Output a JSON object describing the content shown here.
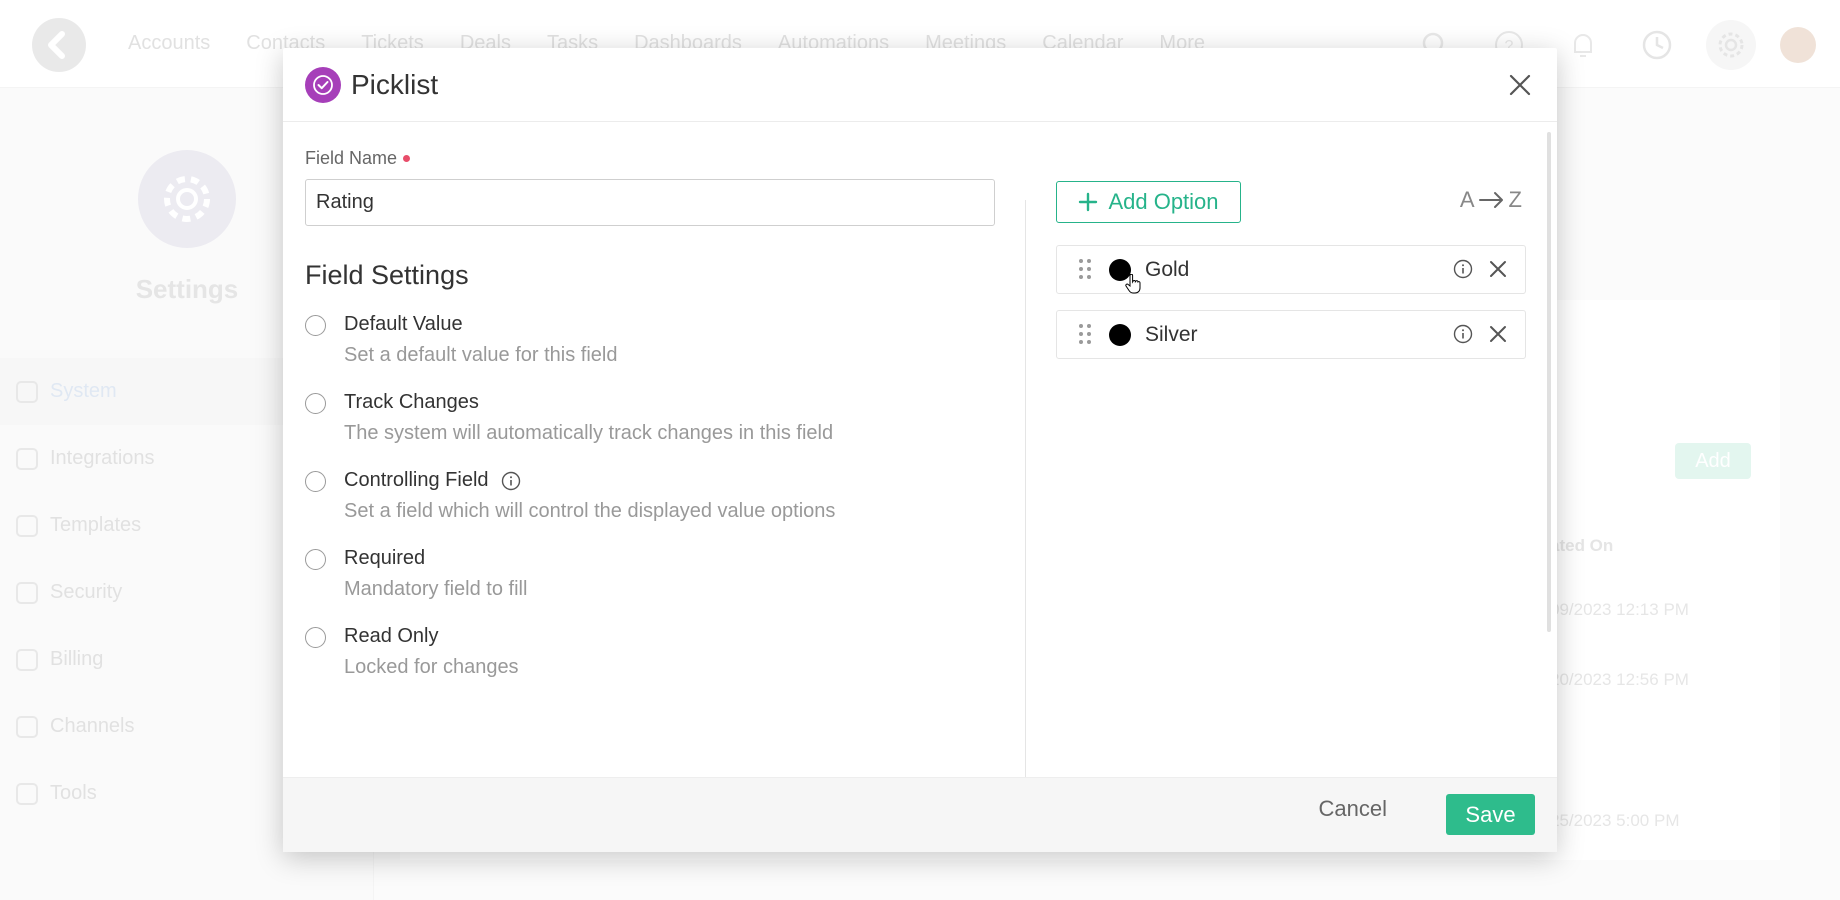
{
  "background": {
    "nav": [
      "Accounts",
      "Contacts",
      "Tickets",
      "Deals",
      "Tasks",
      "Dashboards",
      "Automations",
      "Meetings",
      "Calendar",
      "More"
    ],
    "settings_title": "Settings",
    "sidebar": [
      {
        "label": "System",
        "icon": "gear-icon"
      },
      {
        "label": "Integrations",
        "icon": "share-icon"
      },
      {
        "label": "Templates",
        "icon": "template-icon"
      },
      {
        "label": "Security",
        "icon": "shield-icon"
      },
      {
        "label": "Billing",
        "icon": "card-icon"
      },
      {
        "label": "Channels",
        "icon": "channels-icon"
      },
      {
        "label": "Tools",
        "icon": "tools-icon"
      }
    ],
    "add_label": "Add",
    "column_header": "ated On",
    "rows": [
      "09/2023 12:13 PM",
      "20/2023 12:56 PM",
      "25/2023 5:00 PM"
    ]
  },
  "modal": {
    "title": "Picklist",
    "icon": "check-circle-icon",
    "accent": "#a63fb9",
    "field_name_label": "Field Name",
    "field_name_value": "Rating",
    "settings_title": "Field Settings",
    "settings": [
      {
        "name": "Default Value",
        "desc": "Set a default value for this field",
        "info": false
      },
      {
        "name": "Track Changes",
        "desc": "The system will automatically track changes in this field",
        "info": false
      },
      {
        "name": "Controlling Field",
        "desc": "Set a field which will control the displayed value options",
        "info": true
      },
      {
        "name": "Required",
        "desc": "Mandatory field to fill",
        "info": false
      },
      {
        "name": "Read Only",
        "desc": "Locked for changes",
        "info": false
      }
    ],
    "add_option_label": "Add Option",
    "sort_label_from": "A",
    "sort_label_to": "Z",
    "options": [
      {
        "label": "Gold",
        "color": "#000000"
      },
      {
        "label": "Silver",
        "color": "#000000"
      }
    ],
    "cancel_label": "Cancel",
    "save_label": "Save",
    "save_color": "#2ebc8c"
  }
}
